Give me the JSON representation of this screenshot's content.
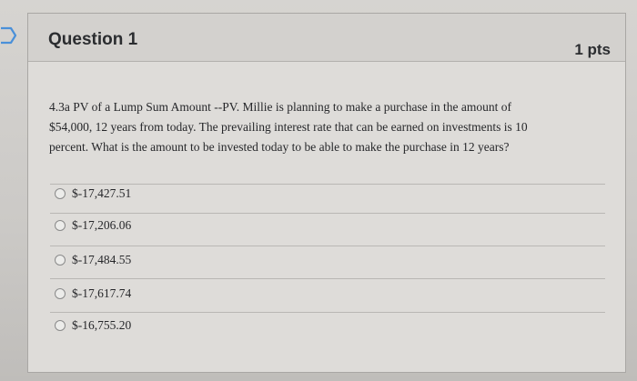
{
  "question": {
    "title": "Question 1",
    "points": "1 pts",
    "text_lines": [
      "4.3a PV of a Lump Sum Amount --PV. Millie is planning to make a purchase in the amount of",
      "$54,000, 12 years from today. The prevailing interest rate that can be earned on investments is 10",
      "percent. What is the amount to be invested today to be able to make the purchase in 12 years?"
    ]
  },
  "options": [
    {
      "label": "$-17,427.51",
      "selected": false
    },
    {
      "label": "$-17,206.06",
      "selected": false
    },
    {
      "label": "$-17,484.55",
      "selected": false
    },
    {
      "label": "$-17,617.74",
      "selected": false
    },
    {
      "label": "$-16,755.20",
      "selected": false
    }
  ],
  "colors": {
    "flag_icon": "#4a90d9",
    "text": "#26272a"
  },
  "icons": {
    "flag": "flag-icon"
  }
}
